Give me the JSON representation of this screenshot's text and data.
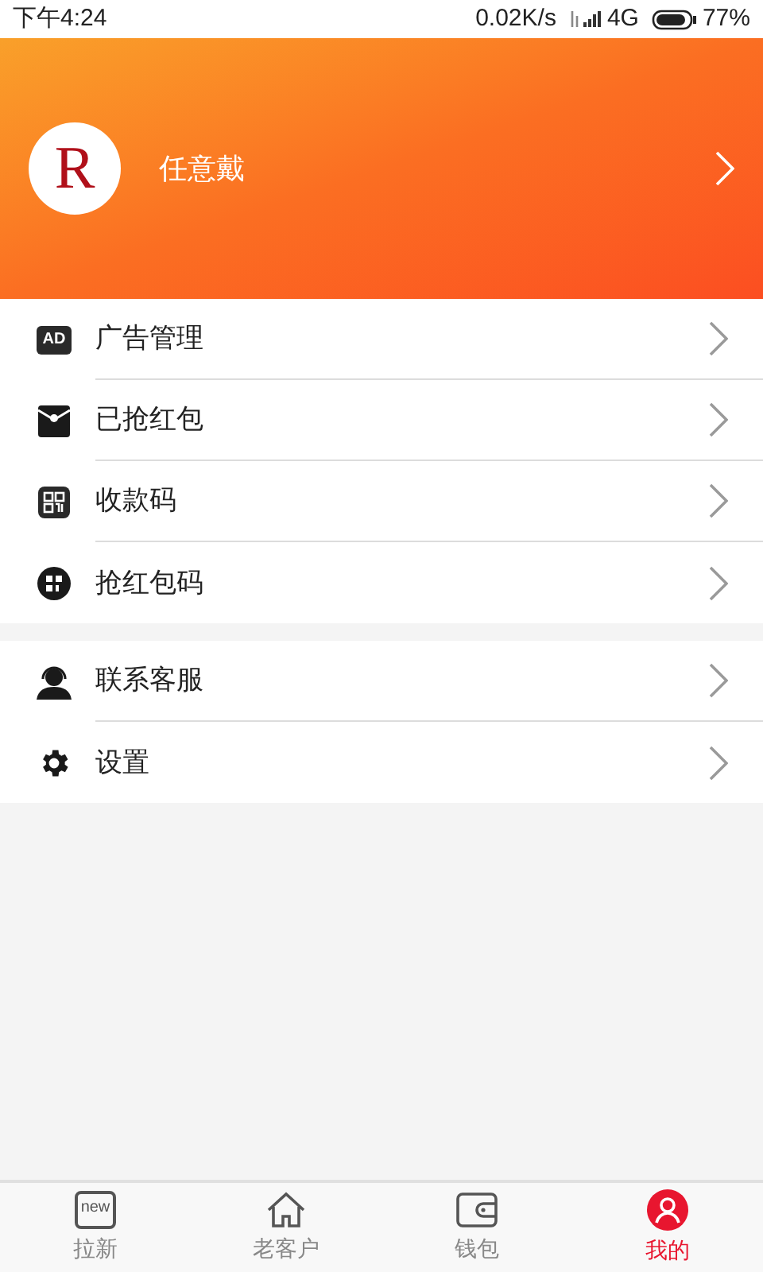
{
  "status_bar": {
    "time": "下午4:24",
    "speed": "0.02K/s",
    "network": "4G",
    "battery": "77%"
  },
  "profile": {
    "avatar_letter": "R",
    "name": "任意戴"
  },
  "menu_groups": [
    {
      "items": [
        {
          "kind": "ad",
          "icon_text": "AD",
          "label": "广告管理"
        },
        {
          "kind": "envelope",
          "label": "已抢红包"
        },
        {
          "kind": "qr",
          "label": "收款码"
        },
        {
          "kind": "qr-round",
          "label": "抢红包码"
        }
      ]
    },
    {
      "items": [
        {
          "kind": "headset",
          "label": "联系客服"
        },
        {
          "kind": "gear",
          "label": "设置"
        }
      ]
    }
  ],
  "tab_bar": [
    {
      "kind": "new",
      "icon_text": "new",
      "label": "拉新",
      "selected": false
    },
    {
      "kind": "home",
      "label": "老客户",
      "selected": false
    },
    {
      "kind": "wallet",
      "label": "钱包",
      "selected": false
    },
    {
      "kind": "user",
      "label": "我的",
      "selected": true
    }
  ]
}
